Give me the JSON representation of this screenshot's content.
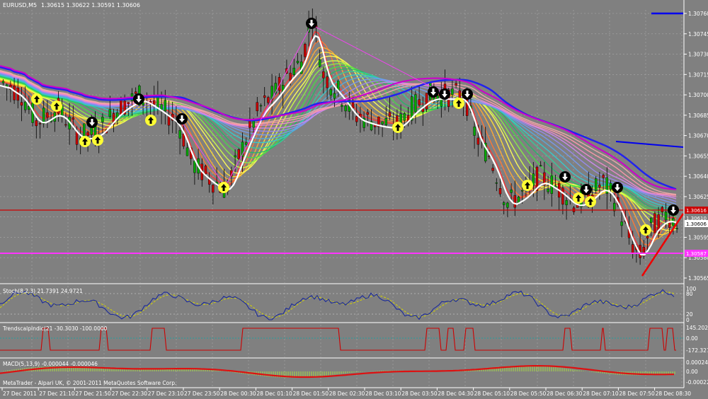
{
  "header": {
    "symbol": "EURUSD,M5",
    "ohlc": "1.30615 1.30622 1.30591 1.30606"
  },
  "main_axis": {
    "ticks": [
      "1.30760",
      "1.30745",
      "1.30730",
      "1.30715",
      "1.30700",
      "1.30685",
      "1.30670",
      "1.30655",
      "1.30640",
      "1.30625",
      "1.30610",
      "1.30595",
      "1.30580",
      "1.30565"
    ],
    "price_tags": [
      {
        "text": "1.30616",
        "bg": "#cc0000",
        "fg": "#ffffff"
      },
      {
        "text": "1.30610",
        "bg": "#808080",
        "fg": "#ffffff"
      },
      {
        "text": "1.30606",
        "bg": "#ffffff",
        "fg": "#000000"
      },
      {
        "text": "1.30587",
        "bg": "#ff33ff",
        "fg": "#ffffff"
      }
    ]
  },
  "stoch": {
    "label": "Stoch(8,2,3) 21.7391 24.9721",
    "ticks": [
      "100",
      "80",
      "20",
      "0"
    ]
  },
  "trend": {
    "label": "TrendscalpIndic(21 -30.3030 -100.0000",
    "ticks": [
      "145.2024",
      "0.00",
      "-172.3274"
    ]
  },
  "macd": {
    "label": "MACD(5,13,9) -0.000044 -0.000046",
    "ticks": [
      "0.000247",
      "0.00",
      "-0.000227"
    ]
  },
  "footer": {
    "copyright": "MetaTrader - Alpari UK, © 2001-2011 MetaQuotes Software Corp."
  },
  "time_axis": [
    "27 Dec 2011",
    "27 Dec 21:10",
    "27 Dec 21:50",
    "27 Dec 22:30",
    "27 Dec 23:10",
    "27 Dec 23:50",
    "28 Dec 00:30",
    "28 Dec 01:10",
    "28 Dec 01:50",
    "28 Dec 02:30",
    "28 Dec 03:10",
    "28 Dec 03:50",
    "28 Dec 04:30",
    "28 Dec 05:10",
    "28 Dec 05:50",
    "28 Dec 06:30",
    "28 Dec 07:10",
    "28 Dec 07:50",
    "28 Dec 08:30"
  ],
  "colors": {
    "background": "#808080",
    "grid": "#a0a0a0",
    "bull": "#00aa00",
    "bear": "#cc0000",
    "stoch_main": "#1a2a9a",
    "stoch_signal": "#d4d400",
    "trend_line": "#cc0000",
    "trend_signal": "#00aaaa",
    "macd_line": "#dd1111",
    "macd_hist": "#aadd44",
    "red_hline": "#cc0000",
    "magenta_hline": "#ff33ff",
    "blue_line": "#0000ee",
    "white_line": "#ffffff"
  },
  "icons": [
    "sell-arrow-icon",
    "buy-arrow-icon"
  ]
}
